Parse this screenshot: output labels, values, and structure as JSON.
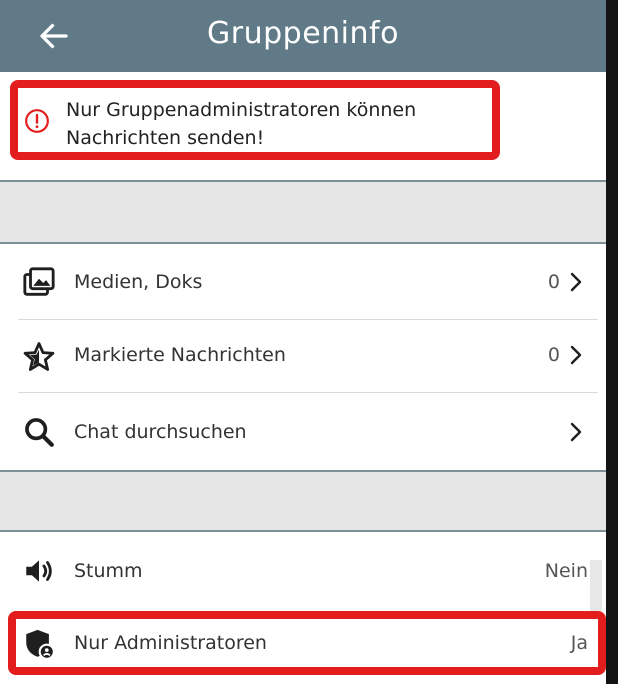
{
  "header": {
    "title": "Gruppeninfo",
    "back_icon": "arrow-left-icon"
  },
  "banner": {
    "icon": "info-icon",
    "line1": "Nur Gruppenadministratoren können",
    "line2": "Nachrichten senden!"
  },
  "media_rows": [
    {
      "icon": "media-gallery-icon",
      "label": "Medien, Doks",
      "value": "0"
    },
    {
      "icon": "star-icon",
      "label": "Markierte Nachrichten",
      "value": "0"
    },
    {
      "icon": "search-icon",
      "label": "Chat durchsuchen",
      "value": ""
    }
  ],
  "settings_rows": [
    {
      "icon": "speaker-mute-icon",
      "label": "Stumm",
      "value": "Nein"
    },
    {
      "icon": "shield-admin-icon",
      "label": "Nur Administratoren",
      "value": "Ja"
    }
  ],
  "colors": {
    "header": "#617a88",
    "highlight": "#e31d1d",
    "section_gray": "#e6e6e6"
  }
}
